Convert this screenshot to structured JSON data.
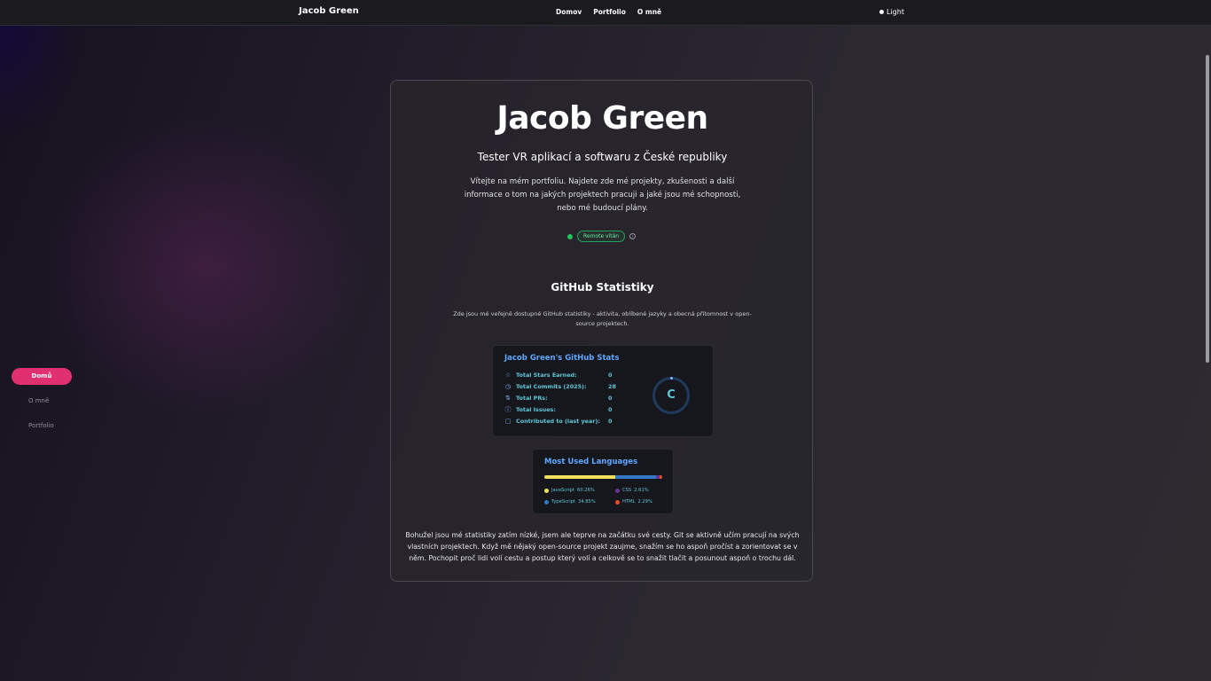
{
  "header": {
    "brand": "Jacob Green",
    "nav": [
      "Domov",
      "Portfolio",
      "O mně"
    ],
    "theme_label": "Light"
  },
  "sidenav": {
    "items": [
      "Domů",
      "O mně",
      "Portfolio"
    ]
  },
  "hero": {
    "title": "Jacob Green",
    "subtitle": "Tester VR aplikací a softwaru z České republiky",
    "description": "Vítejte na mém portfoliu. Najdete zde mé projekty, zkušenosti a další informace o tom na jakých projektech pracuji a jaké jsou mé schopnosti, nebo mé budoucí plány.",
    "status_badge": "Remote vítán"
  },
  "github": {
    "title": "GitHub Statistiky",
    "description": "Zde jsou mé veřejně dostupné GitHub statistiky - aktivita, oblíbené jazyky a obecná přítomnost v open-source projektech.",
    "stats_card": {
      "title": "Jacob Green's GitHub Stats",
      "rows": [
        {
          "label": "Total Stars Earned:",
          "value": "0",
          "icon": "star-icon"
        },
        {
          "label": "Total Commits (2025):",
          "value": "28",
          "icon": "history-icon"
        },
        {
          "label": "Total PRs:",
          "value": "0",
          "icon": "pull-request-icon"
        },
        {
          "label": "Total Issues:",
          "value": "0",
          "icon": "issue-icon"
        },
        {
          "label": "Contributed to (last year):",
          "value": "0",
          "icon": "repo-icon"
        }
      ],
      "rank": "C"
    },
    "languages_card": {
      "title": "Most Used Languages",
      "languages": [
        {
          "name": "JavaScript",
          "percent": "60.26%",
          "value": 60.26,
          "color": "#f1e05a"
        },
        {
          "name": "TypeScript",
          "percent": "34.85%",
          "value": 34.85,
          "color": "#3178c6"
        },
        {
          "name": "CSS",
          "percent": "2.61%",
          "value": 2.61,
          "color": "#663399"
        },
        {
          "name": "HTML",
          "percent": "2.29%",
          "value": 2.29,
          "color": "#e34c26"
        }
      ]
    },
    "closing_text": "Bohužel jsou mé statistiky zatím nízké, jsem ale teprve na začátku své cesty. Git se aktivně učím pracují na svých vlastních projektech. Když mě nějaký open-source projekt zaujme, snažím se ho aspoň pročíst a zorientovat se v něm. Pochopit proč lidi volí cestu a postup který volí a celkově se to snažit tlačit a posunout aspoň o trochu dál."
  }
}
